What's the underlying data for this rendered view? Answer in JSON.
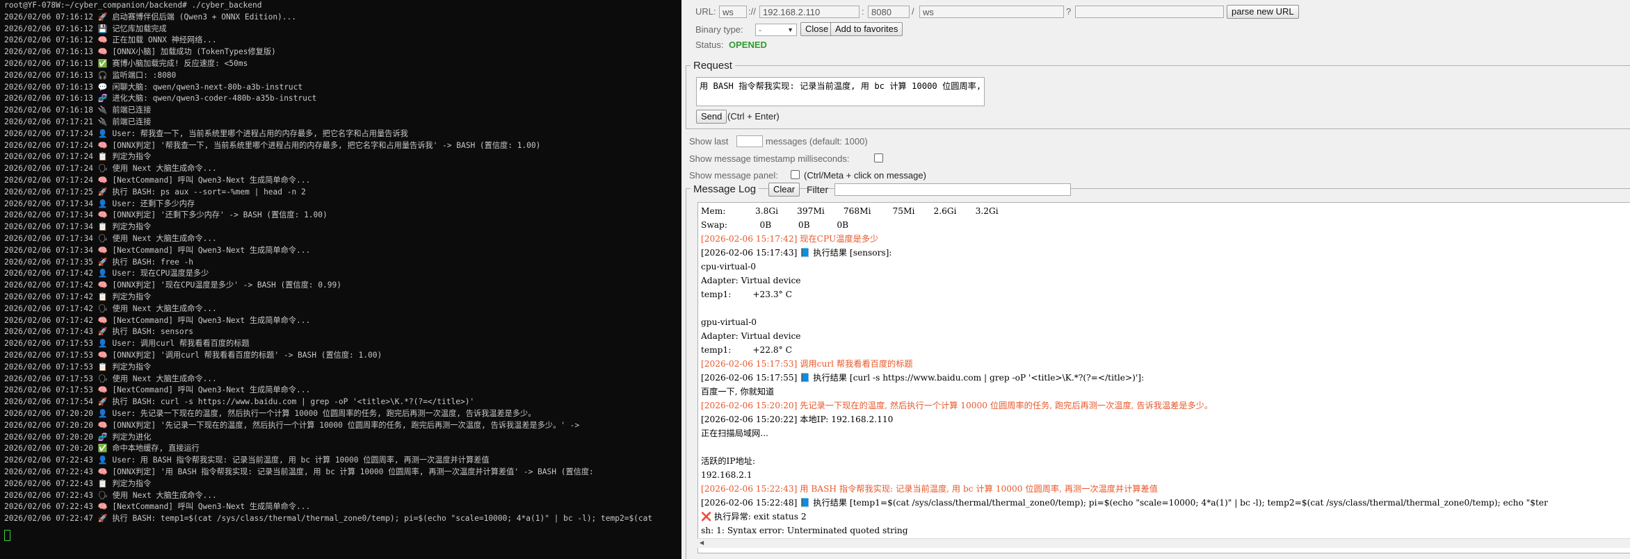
{
  "terminal": {
    "lines": [
      "root@YF-078W:~/cyber_companion/backend# ./cyber_backend",
      "2026/02/06 07:16:12 🚀 启动赛博伴侣后端 (Qwen3 + ONNX Edition)...",
      "2026/02/06 07:16:12 💾 记忆库加载完成",
      "2026/02/06 07:16:12 🧠 正在加载 ONNX 神经网络...",
      "2026/02/06 07:16:13 🧠 [ONNX小脑] 加载成功 (TokenTypes修复版)",
      "2026/02/06 07:16:13 ✅ 赛博小脑加载完成! 反应速度: <50ms",
      "2026/02/06 07:16:13 🎧 监听端口: :8080",
      "2026/02/06 07:16:13 💬 闲聊大脑: qwen/qwen3-next-80b-a3b-instruct",
      "2026/02/06 07:16:13 🧬 进化大脑: qwen/qwen3-coder-480b-a35b-instruct",
      "2026/02/06 07:16:18 🔌 前端已连接",
      "2026/02/06 07:17:21 🔌 前端已连接",
      "2026/02/06 07:17:24 👤 User: 帮我查一下, 当前系统里哪个进程占用的内存最多, 把它名字和占用量告诉我",
      "2026/02/06 07:17:24 🧠 [ONNX判定] '帮我查一下, 当前系统里哪个进程占用的内存最多, 把它名字和占用量告诉我' -> BASH (置信度: 1.00)",
      "2026/02/06 07:17:24 📋 判定为指令",
      "2026/02/06 07:17:24 🗣 使用 Next 大脑生成命令...",
      "2026/02/06 07:17:24 🧠 [NextCommand] 呼叫 Qwen3-Next 生成简单命令...",
      "2026/02/06 07:17:25 🚀 执行 BASH: ps aux --sort=-%mem | head -n 2",
      "2026/02/06 07:17:34 👤 User: 还剩下多少内存",
      "2026/02/06 07:17:34 🧠 [ONNX判定] '还剩下多少内存' -> BASH (置信度: 1.00)",
      "2026/02/06 07:17:34 📋 判定为指令",
      "2026/02/06 07:17:34 🗣 使用 Next 大脑生成命令...",
      "2026/02/06 07:17:34 🧠 [NextCommand] 呼叫 Qwen3-Next 生成简单命令...",
      "2026/02/06 07:17:35 🚀 执行 BASH: free -h",
      "2026/02/06 07:17:42 👤 User: 现在CPU温度是多少",
      "2026/02/06 07:17:42 🧠 [ONNX判定] '现在CPU温度是多少' -> BASH (置信度: 0.99)",
      "2026/02/06 07:17:42 📋 判定为指令",
      "2026/02/06 07:17:42 🗣 使用 Next 大脑生成命令...",
      "2026/02/06 07:17:42 🧠 [NextCommand] 呼叫 Qwen3-Next 生成简单命令...",
      "2026/02/06 07:17:43 🚀 执行 BASH: sensors",
      "2026/02/06 07:17:53 👤 User: 调用curl 帮我看看百度的标题",
      "2026/02/06 07:17:53 🧠 [ONNX判定] '调用curl 帮我看看百度的标题' -> BASH (置信度: 1.00)",
      "2026/02/06 07:17:53 📋 判定为指令",
      "2026/02/06 07:17:53 🗣 使用 Next 大脑生成命令...",
      "2026/02/06 07:17:53 🧠 [NextCommand] 呼叫 Qwen3-Next 生成简单命令...",
      "2026/02/06 07:17:54 🚀 执行 BASH: curl -s https://www.baidu.com | grep -oP '<title>\\K.*?(?=</title>)'",
      "2026/02/06 07:20:20 👤 User: 先记录一下现在的温度, 然后执行一个计算 10000 位圆周率的任务, 跑完后再测一次温度, 告诉我温差是多少。",
      "2026/02/06 07:20:20 🧠 [ONNX判定] '先记录一下现在的温度, 然后执行一个计算 10000 位圆周率的任务, 跑完后再测一次温度, 告诉我温差是多少。' ->",
      "2026/02/06 07:20:20 🧬 判定为进化",
      "2026/02/06 07:20:20 ✅ 命中本地缓存, 直接运行",
      "2026/02/06 07:22:43 👤 User: 用 BASH 指令帮我实现: 记录当前温度, 用 bc 计算 10000 位圆周率, 再测一次温度并计算差值",
      "2026/02/06 07:22:43 🧠 [ONNX判定] '用 BASH 指令帮我实现: 记录当前温度, 用 bc 计算 10000 位圆周率, 再测一次温度并计算差值' -> BASH (置信度:",
      "2026/02/06 07:22:43 📋 判定为指令",
      "2026/02/06 07:22:43 🗣 使用 Next 大脑生成命令...",
      "2026/02/06 07:22:43 🧠 [NextCommand] 呼叫 Qwen3-Next 生成简单命令...",
      "2026/02/06 07:22:47 🚀 执行 BASH: temp1=$(cat /sys/class/thermal/thermal_zone0/temp); pi=$(echo \"scale=10000; 4*a(1)\" | bc -l); temp2=$(cat"
    ]
  },
  "tool": {
    "url_label": "URL:",
    "scheme": "ws",
    "sep1": "://",
    "host": "192.168.2.110",
    "colon": ":",
    "port": "8080",
    "slash": "/",
    "path": "ws",
    "qmark": "?",
    "query": "",
    "parse_button": "parse new URL",
    "binary_label": "Binary type:",
    "binary_value": "-",
    "close_button": "Close",
    "favorites_button": "Add to favorites",
    "status_label": "Status:",
    "status_value": "OPENED",
    "status_color": "#2e9c2e",
    "request_legend": "Request",
    "request_text": "用 BASH 指令帮我实现: 记录当前温度, 用 bc 计算 10000 位圆周率, 再测一次温度并计算差值",
    "send_button": "Send",
    "send_hint": "(Ctrl + Enter)",
    "show_last_label": "Show last",
    "show_last_value": "",
    "show_last_suffix": "messages (default: 1000)",
    "ms_label": "Show message timestamp milliseconds:",
    "panel_label": "Show message panel:",
    "panel_hint": "(Ctrl/Meta + click on message)",
    "log_legend": "Message Log",
    "clear_button": "Clear",
    "filter_label": "Filter",
    "filter_value": "",
    "log_lines": [
      {
        "t": "Mem:           3.8Gi       397Mi       768Mi        75Mi       2.6Gi       3.2Gi",
        "red": false
      },
      {
        "t": "Swap:            0B          0B          0B",
        "red": false
      },
      {
        "t": "[2026-02-06 15:17:42] 现在CPU温度是多少",
        "red": true
      },
      {
        "t": "[2026-02-06 15:17:43] 📘 执行结果 [sensors]:",
        "red": false
      },
      {
        "t": "cpu-virtual-0",
        "red": false
      },
      {
        "t": "Adapter: Virtual device",
        "red": false
      },
      {
        "t": "temp1:        +23.3° C",
        "red": false
      },
      {
        "t": "",
        "red": false
      },
      {
        "t": "gpu-virtual-0",
        "red": false
      },
      {
        "t": "Adapter: Virtual device",
        "red": false
      },
      {
        "t": "temp1:        +22.8° C",
        "red": false
      },
      {
        "t": "[2026-02-06 15:17:53] 调用curl 帮我看看百度的标题",
        "red": true
      },
      {
        "t": "[2026-02-06 15:17:55] 📘 执行结果 [curl -s https://www.baidu.com | grep -oP '<title>\\K.*?(?=</title>)']:",
        "red": false
      },
      {
        "t": "百度一下, 你就知道",
        "red": false
      },
      {
        "t": "[2026-02-06 15:20:20] 先记录一下现在的温度, 然后执行一个计算 10000 位圆周率的任务, 跑完后再测一次温度, 告诉我温差是多少。",
        "red": true
      },
      {
        "t": "[2026-02-06 15:20:22] 本地IP: 192.168.2.110",
        "red": false
      },
      {
        "t": "正在扫描局域网...",
        "red": false
      },
      {
        "t": "",
        "red": false
      },
      {
        "t": "活跃的IP地址:",
        "red": false
      },
      {
        "t": "192.168.2.1",
        "red": false
      },
      {
        "t": "[2026-02-06 15:22:43] 用 BASH 指令帮我实现: 记录当前温度, 用 bc 计算 10000 位圆周率, 再测一次温度并计算差值",
        "red": true
      },
      {
        "t": "[2026-02-06 15:22:48] 📘 执行结果 [temp1=$(cat /sys/class/thermal/thermal_zone0/temp); pi=$(echo \"scale=10000; 4*a(1)\" | bc -l); temp2=$(cat /sys/class/thermal/thermal_zone0/temp); echo \"$ter",
        "red": false
      },
      {
        "t": "❌ 执行异常: exit status 2",
        "red": false
      },
      {
        "t": "sh: 1: Syntax error: Unterminated quoted string",
        "red": false
      }
    ]
  }
}
